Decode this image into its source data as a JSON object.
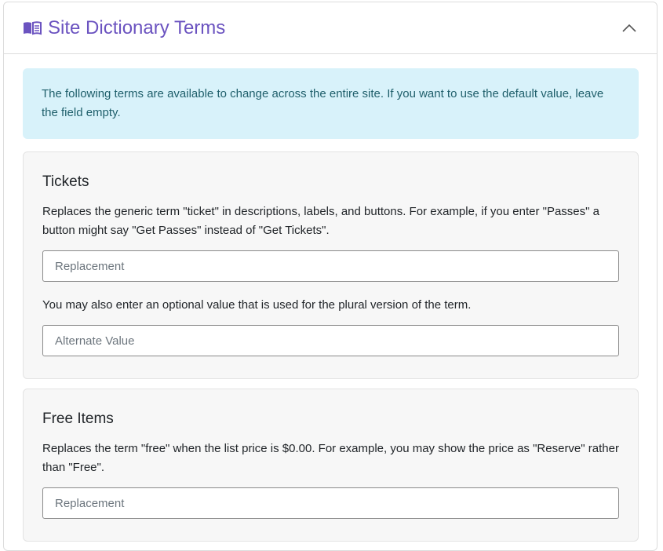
{
  "header": {
    "title": "Site Dictionary Terms",
    "icon": "book-icon",
    "toggle_icon": "chevron-up-icon",
    "accent_color": "#6b53c0"
  },
  "alert": {
    "text": "The following terms are available to change across the entire site. If you want to use the default value, leave the field empty."
  },
  "sections": [
    {
      "title": "Tickets",
      "description": "Replaces the generic term \"ticket\" in descriptions, labels, and buttons. For example, if you enter \"Passes\" a button might say \"Get Passes\" instead of \"Get Tickets\".",
      "replacement_placeholder": "Replacement",
      "plural_description": "You may also enter an optional value that is used for the plural version of the term.",
      "alternate_placeholder": "Alternate Value"
    },
    {
      "title": "Free Items",
      "description": "Replaces the term \"free\" when the list price is $0.00. For example, you may show the price as \"Reserve\" rather than \"Free\".",
      "replacement_placeholder": "Replacement"
    }
  ]
}
